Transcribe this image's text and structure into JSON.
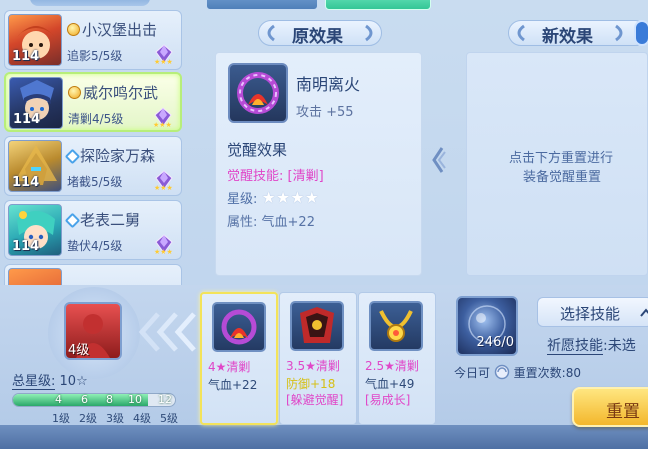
{
  "heroes": [
    {
      "name": "小汉堡出击",
      "skill": "追影5/5级",
      "level": "114",
      "mark": "gold",
      "active": false
    },
    {
      "name": "威尔鸣尔武",
      "skill": "清剿4/5级",
      "level": "114",
      "mark": "gold",
      "active": true
    },
    {
      "name": "探险家万森",
      "skill": "堵截5/5级",
      "level": "114",
      "mark": "blue",
      "active": false
    },
    {
      "name": "老表二舅",
      "skill": "蛰伏4/5级",
      "level": "114",
      "mark": "blue",
      "active": false
    }
  ],
  "original": {
    "title": "原效果",
    "item_name": "南明离火",
    "item_stat": "攻击 +55",
    "section_title": "觉醒效果",
    "skill_label": "觉醒技能:",
    "skill_value": "[清剿]",
    "star_label": "星级:",
    "stars": "★★★★",
    "attr_label": "属性:",
    "attr_value": "气血+22"
  },
  "new_effect": {
    "title": "新效果",
    "hint_line1": "点击下方重置进行",
    "hint_line2": "装备觉醒重置"
  },
  "current_item": {
    "level_label": "4级"
  },
  "total_star": {
    "label": "总星级:",
    "value": "10☆"
  },
  "progress": {
    "current": 10,
    "max": 12,
    "ticks": [
      "4",
      "6",
      "8",
      "10",
      "12"
    ],
    "levels": [
      "1级",
      "2级",
      "3级",
      "4级",
      "5级"
    ]
  },
  "equipment": [
    {
      "star": "4★清剿",
      "attr": "气血+22",
      "extra": "",
      "selected": true,
      "star_color": "#e046c8",
      "attr_color": "#2e4a78"
    },
    {
      "star": "3.5★清剿",
      "attr": "防御+18",
      "extra": "[躲避觉醒]",
      "selected": false,
      "star_color": "#e046c8",
      "attr_color": "#d6c016"
    },
    {
      "star": "2.5★清剿",
      "attr": "气血+49",
      "extra": "[易成长]",
      "selected": false,
      "star_color": "#e046c8",
      "attr_color": "#2e4a78"
    }
  ],
  "skill_select": {
    "button_label": "选择技能",
    "count": "246/0",
    "wish_label": "祈愿技能",
    "wish_value": ":未选",
    "today_label": "今日可",
    "reset_label": "重置次数:",
    "reset_count": "80"
  },
  "reset_button": "重置",
  "colors": {
    "accent_pink": "#e046c8",
    "accent_gold": "#f3b72c",
    "text_blue": "#2e4a78"
  }
}
